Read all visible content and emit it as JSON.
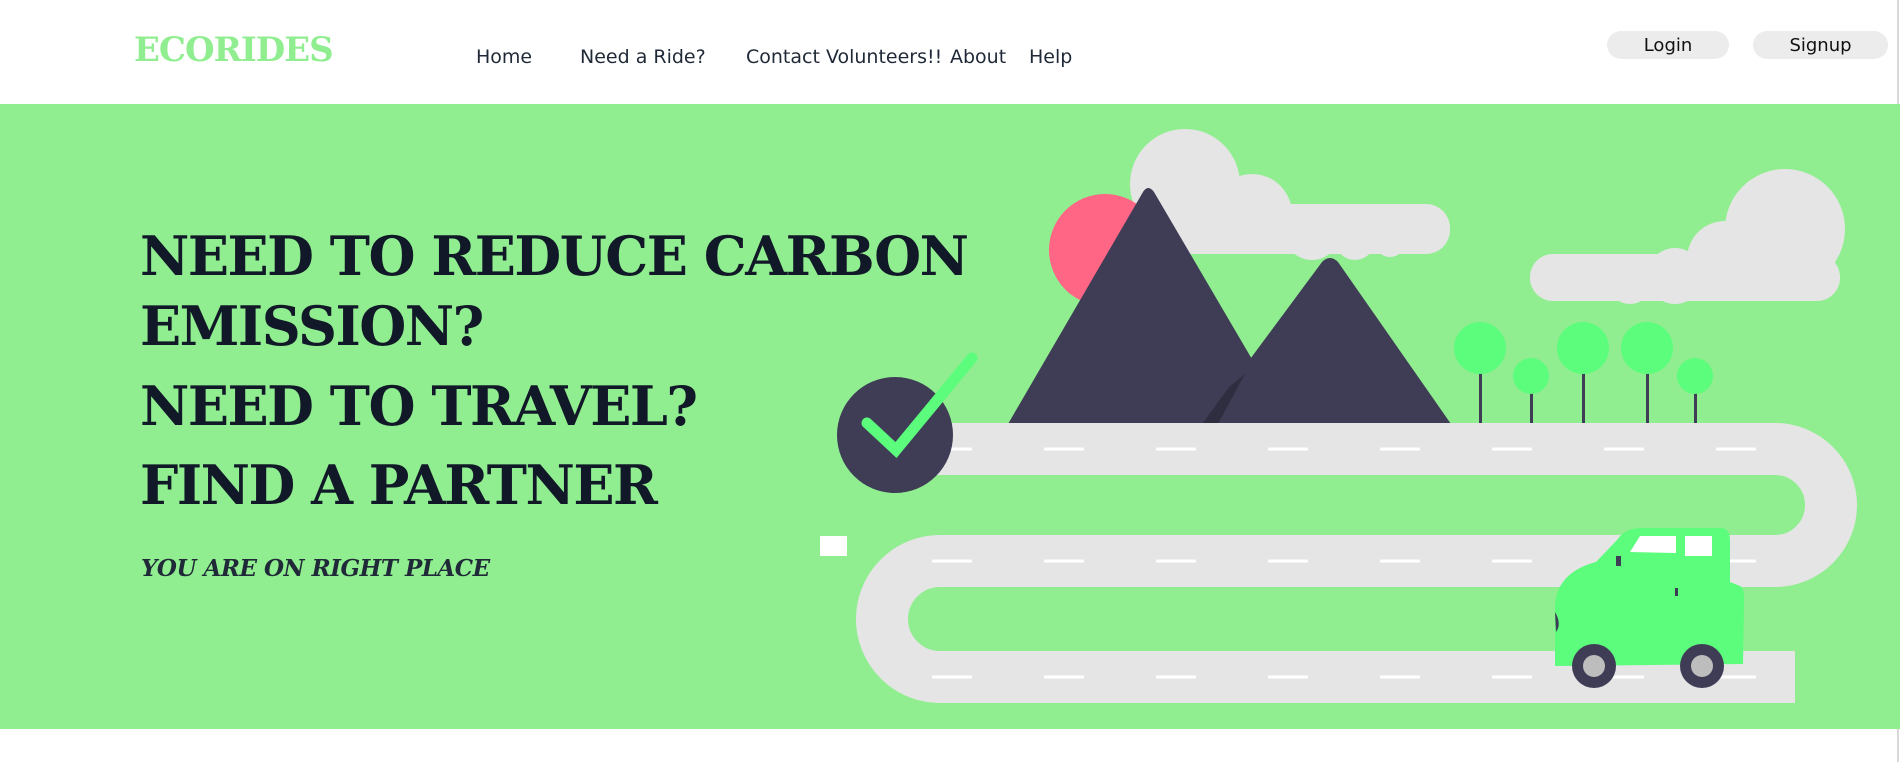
{
  "brand": {
    "name": "ECORIDES"
  },
  "nav": {
    "items": [
      {
        "label": "Home"
      },
      {
        "label": "Need a Ride?"
      },
      {
        "label": "Contact Volunteers!!"
      },
      {
        "label": "About"
      },
      {
        "label": "Help"
      }
    ]
  },
  "auth": {
    "login_label": "Login",
    "signup_label": "Signup"
  },
  "hero": {
    "headline_lines": [
      "NEED TO REDUCE CARBON",
      "EMISSION?",
      "NEED TO TRAVEL?",
      "FIND A PARTNER"
    ],
    "tagline": "YOU ARE ON RIGHT PLACE"
  },
  "colors": {
    "brand": "#90ee90",
    "hero_background": "#90ee90",
    "text_dark": "#111827",
    "road": "#e5e5e5",
    "mountain": "#3f3d56",
    "sun": "#ff6584",
    "accent_green": "#5cfc7c"
  },
  "icons": {
    "checkmark": "check-circle-icon",
    "car": "car-icon"
  }
}
